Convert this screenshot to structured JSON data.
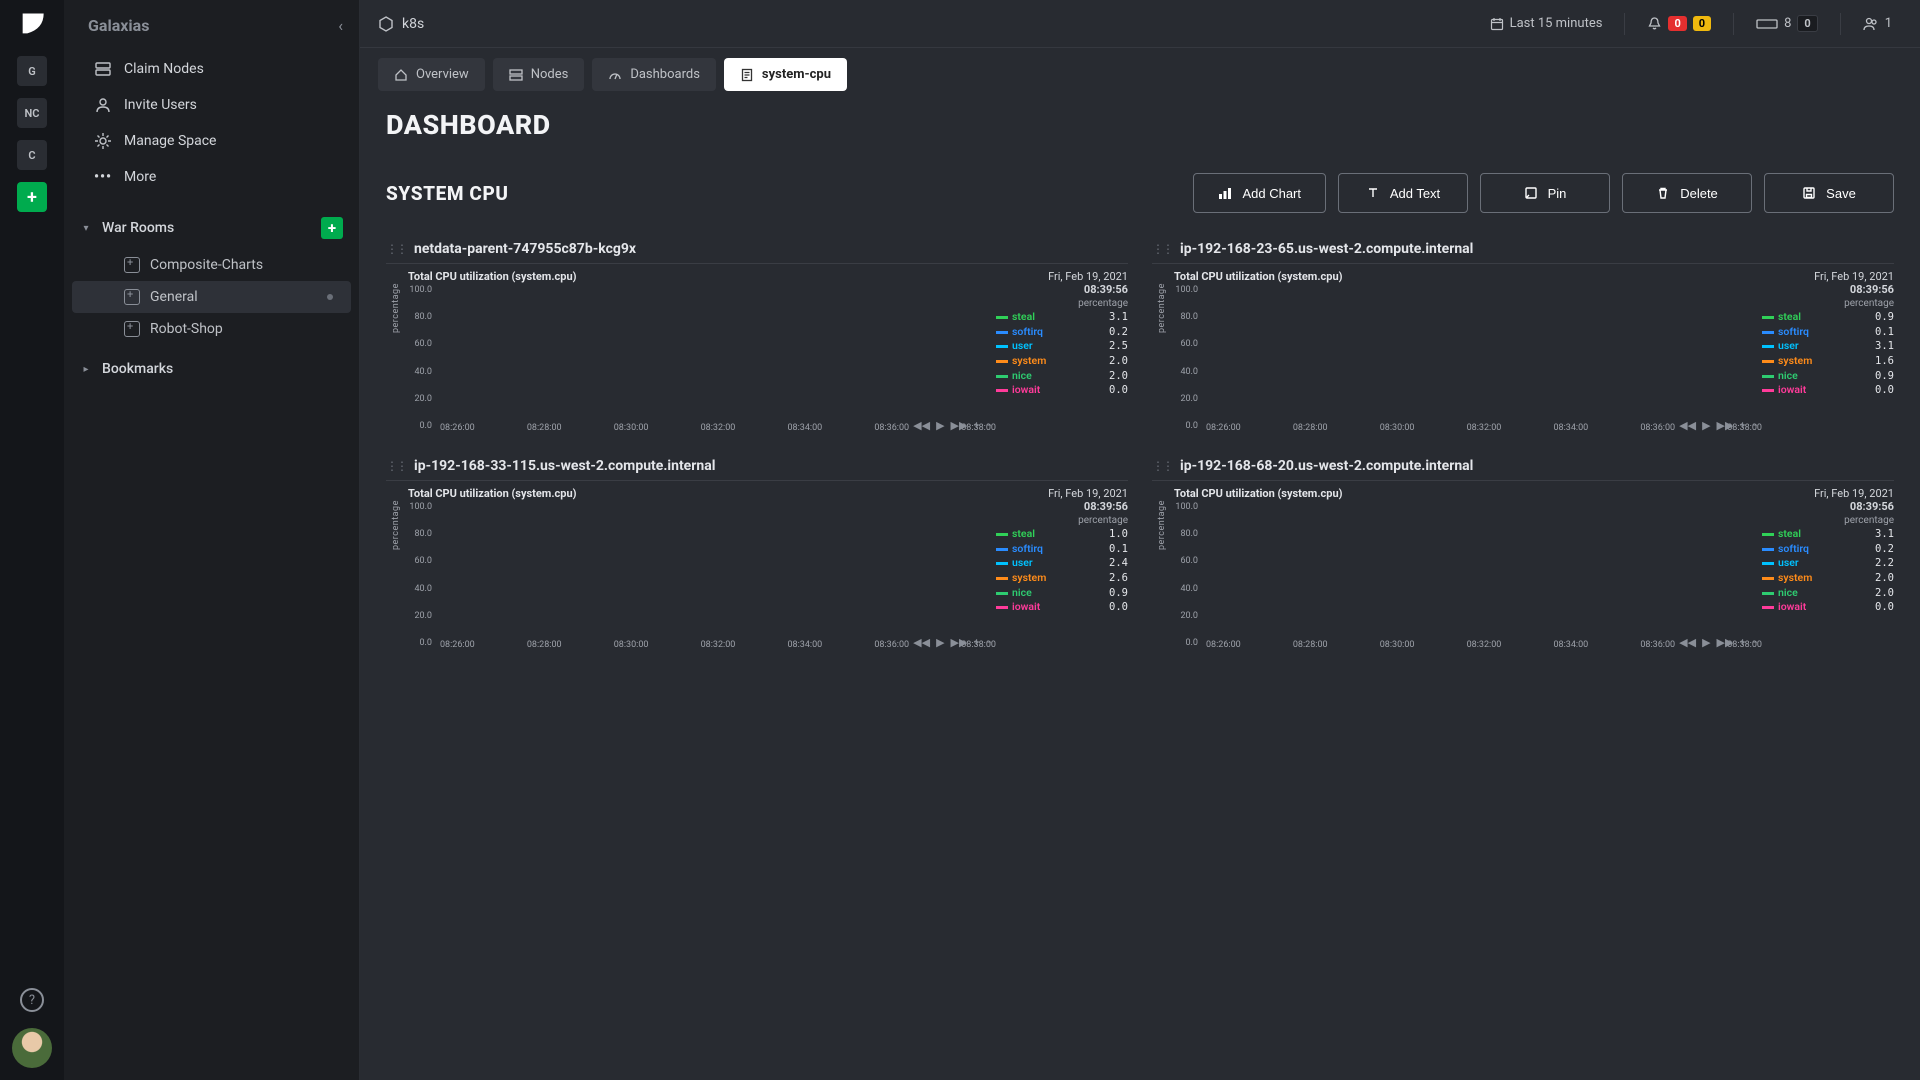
{
  "app_badges": [
    "G",
    "NC",
    "C"
  ],
  "sidebar": {
    "title": "Galaxias",
    "items": {
      "claim": "Claim Nodes",
      "invite": "Invite Users",
      "manage": "Manage Space",
      "more": "More"
    },
    "warrooms_label": "War Rooms",
    "rooms": [
      {
        "label": "Composite-Charts",
        "active": false
      },
      {
        "label": "General",
        "active": true
      },
      {
        "label": "Robot-Shop",
        "active": false
      }
    ],
    "bookmarks_label": "Bookmarks"
  },
  "topbar": {
    "crumb": "k8s",
    "time_label": "Last 15 minutes",
    "alerts_red": "0",
    "alerts_yellow": "0",
    "nodes": "8",
    "nodes_off": "0",
    "users": "1"
  },
  "tabs": {
    "overview": "Overview",
    "nodes": "Nodes",
    "dashboards": "Dashboards",
    "doc": "system-cpu"
  },
  "page": {
    "title": "DASHBOARD",
    "section": "SYSTEM CPU",
    "buttons": {
      "add_chart": "Add Chart",
      "add_text": "Add Text",
      "pin": "Pin",
      "delete": "Delete",
      "save": "Save"
    }
  },
  "chart_common": {
    "subtitle": "Total CPU utilization (system.cpu)",
    "date": "Fri, Feb 19, 2021",
    "time": "08:39:56",
    "unit": "percentage",
    "y_ticks": [
      "100.0",
      "80.0",
      "60.0",
      "40.0",
      "20.0",
      "0.0"
    ],
    "x_ticks": [
      "08:26:00",
      "08:28:00",
      "08:30:00",
      "08:32:00",
      "08:34:00",
      "08:36:00",
      "08:38:00"
    ],
    "y_label": "percentage"
  },
  "legend_meta": [
    {
      "name": "steal",
      "color": "#30d158"
    },
    {
      "name": "softirq",
      "color": "#2a8cff"
    },
    {
      "name": "user",
      "color": "#00c2ff"
    },
    {
      "name": "system",
      "color": "#ff8c1a"
    },
    {
      "name": "nice",
      "color": "#2ecc71"
    },
    {
      "name": "iowait",
      "color": "#ff3b9a"
    }
  ],
  "charts": [
    {
      "host": "netdata-parent-747955c87b-kcg9x",
      "values": [
        3.1,
        0.2,
        2.5,
        2.0,
        2.0,
        0.0
      ]
    },
    {
      "host": "ip-192-168-23-65.us-west-2.compute.internal",
      "values": [
        0.9,
        0.1,
        3.1,
        1.6,
        0.9,
        0.0
      ]
    },
    {
      "host": "ip-192-168-33-115.us-west-2.compute.internal",
      "values": [
        1.0,
        0.1,
        2.4,
        2.6,
        0.9,
        0.0
      ]
    },
    {
      "host": "ip-192-168-68-20.us-west-2.compute.internal",
      "values": [
        3.1,
        0.2,
        2.2,
        2.0,
        2.0,
        0.0
      ]
    }
  ],
  "chart_data": [
    {
      "type": "area",
      "title": "Total CPU utilization (system.cpu)",
      "ylim": [
        0,
        100
      ],
      "host": "netdata-parent-747955c87b-kcg9x",
      "series": [
        {
          "name": "steal",
          "value": 3.1
        },
        {
          "name": "softirq",
          "value": 0.2
        },
        {
          "name": "user",
          "value": 2.5
        },
        {
          "name": "system",
          "value": 2.0
        },
        {
          "name": "nice",
          "value": 2.0
        },
        {
          "name": "iowait",
          "value": 0.0
        }
      ]
    },
    {
      "type": "area",
      "title": "Total CPU utilization (system.cpu)",
      "ylim": [
        0,
        100
      ],
      "host": "ip-192-168-23-65.us-west-2.compute.internal",
      "series": [
        {
          "name": "steal",
          "value": 0.9
        },
        {
          "name": "softirq",
          "value": 0.1
        },
        {
          "name": "user",
          "value": 3.1
        },
        {
          "name": "system",
          "value": 1.6
        },
        {
          "name": "nice",
          "value": 0.9
        },
        {
          "name": "iowait",
          "value": 0.0
        }
      ]
    },
    {
      "type": "area",
      "title": "Total CPU utilization (system.cpu)",
      "ylim": [
        0,
        100
      ],
      "host": "ip-192-168-33-115.us-west-2.compute.internal",
      "series": [
        {
          "name": "steal",
          "value": 1.0
        },
        {
          "name": "softirq",
          "value": 0.1
        },
        {
          "name": "user",
          "value": 2.4
        },
        {
          "name": "system",
          "value": 2.6
        },
        {
          "name": "nice",
          "value": 0.9
        },
        {
          "name": "iowait",
          "value": 0.0
        }
      ]
    },
    {
      "type": "area",
      "title": "Total CPU utilization (system.cpu)",
      "ylim": [
        0,
        100
      ],
      "host": "ip-192-168-68-20.us-west-2.compute.internal",
      "series": [
        {
          "name": "steal",
          "value": 3.1
        },
        {
          "name": "softirq",
          "value": 0.2
        },
        {
          "name": "user",
          "value": 2.2
        },
        {
          "name": "system",
          "value": 2.0
        },
        {
          "name": "nice",
          "value": 2.0
        },
        {
          "name": "iowait",
          "value": 0.0
        }
      ]
    }
  ]
}
